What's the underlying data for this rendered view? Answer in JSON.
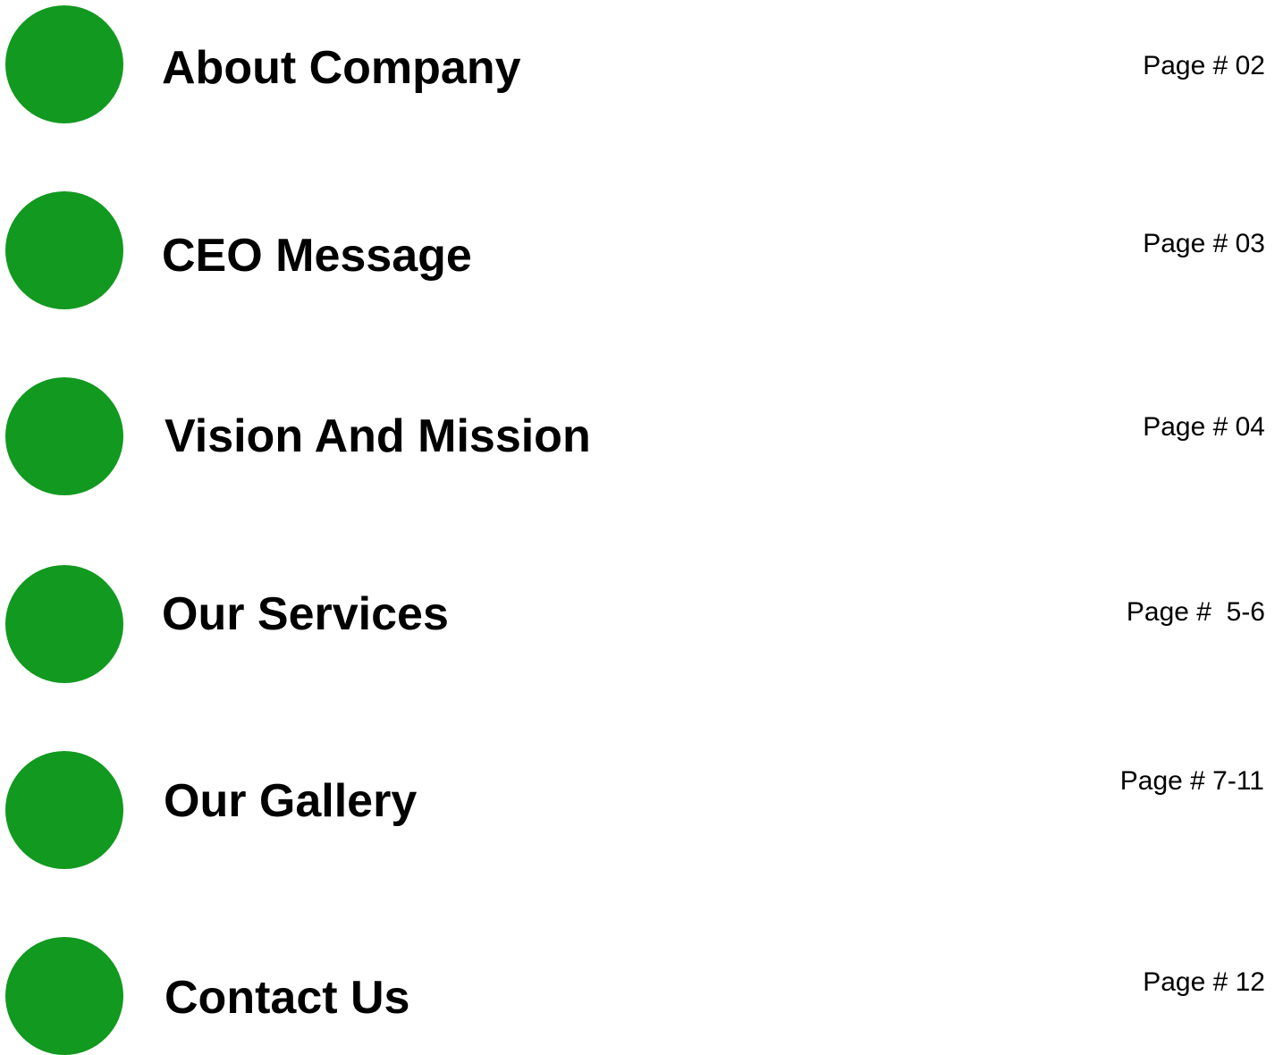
{
  "colors": {
    "bullet": "#12991f",
    "text": "#000000",
    "background": "#ffffff"
  },
  "toc": [
    {
      "title": "About Company",
      "page": "Page # 02"
    },
    {
      "title": "CEO Message",
      "page": "Page # 03"
    },
    {
      "title": "Vision And Mission",
      "page": "Page # 04"
    },
    {
      "title": "Our Services",
      "page": "Page #  5-6"
    },
    {
      "title": "Our Gallery",
      "page": "Page # 7-11"
    },
    {
      "title": "Contact Us",
      "page": "Page # 12"
    }
  ]
}
